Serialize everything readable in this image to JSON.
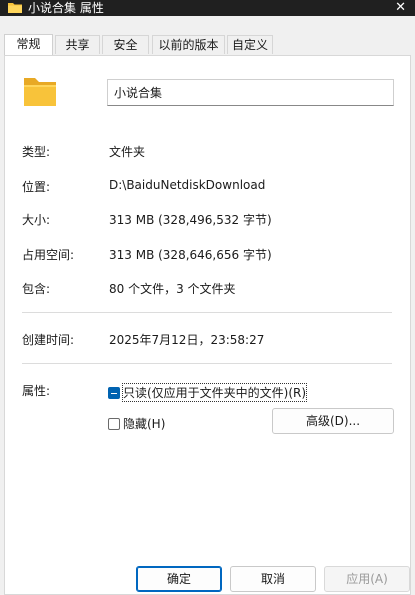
{
  "window": {
    "title": "小说合集 属性",
    "close_glyph": "✕"
  },
  "tabs": [
    {
      "label": "常规",
      "active": true
    },
    {
      "label": "共享"
    },
    {
      "label": "安全"
    },
    {
      "label": "以前的版本"
    },
    {
      "label": "自定义"
    }
  ],
  "general": {
    "name_value": "小说合集",
    "rows": [
      {
        "label": "类型:",
        "value": "文件夹"
      },
      {
        "label": "位置:",
        "value": "D:\\BaiduNetdiskDownload"
      },
      {
        "label": "大小:",
        "value": "313 MB (328,496,532 字节)"
      },
      {
        "label": "占用空间:",
        "value": "313 MB (328,646,656 字节)"
      },
      {
        "label": "包含:",
        "value": "80 个文件，3 个文件夹"
      }
    ],
    "created": {
      "label": "创建时间:",
      "value": "2025年7月12日，23:58:27"
    },
    "attributes": {
      "label": "属性:",
      "readonly_label": "只读(仅应用于文件夹中的文件)(R)",
      "hidden_label": "隐藏(H)",
      "advanced_label": "高级(D)..."
    }
  },
  "footer": {
    "ok_label": "确定",
    "cancel_label": "取消",
    "apply_label": "应用(A)"
  },
  "colors": {
    "accent": "#0063b1",
    "titlebar": "#202020",
    "folder": "#f8c33a"
  }
}
